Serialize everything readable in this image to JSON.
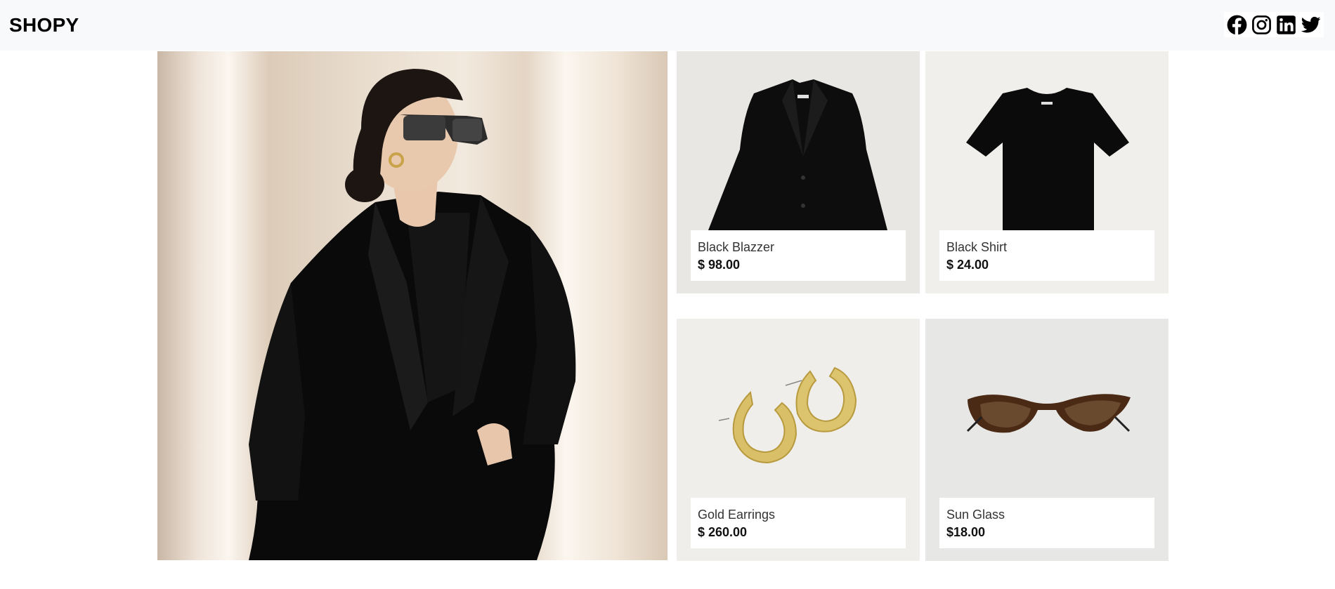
{
  "brand": "SHOPY",
  "social": [
    {
      "icon": "facebook-icon"
    },
    {
      "icon": "instagram-icon"
    },
    {
      "icon": "linkedin-icon"
    },
    {
      "icon": "twitter-icon"
    }
  ],
  "hero": {
    "image": "woman-in-black-blazer-photo"
  },
  "products": [
    {
      "name": "Black Blazzer",
      "price": "$ 98.00",
      "image": "black-blazer-photo"
    },
    {
      "name": "Black Shirt",
      "price": "$ 24.00",
      "image": "black-tshirt-photo"
    },
    {
      "name": "Gold Earrings",
      "price": "$ 260.00",
      "image": "gold-earrings-photo"
    },
    {
      "name": "Sun Glass",
      "price": "$18.00",
      "image": "cat-eye-sunglasses-photo"
    }
  ],
  "colors": {
    "navbar_bg": "#f8f9fa",
    "brand": "#000000",
    "card_bg": "#e9e7e4"
  }
}
